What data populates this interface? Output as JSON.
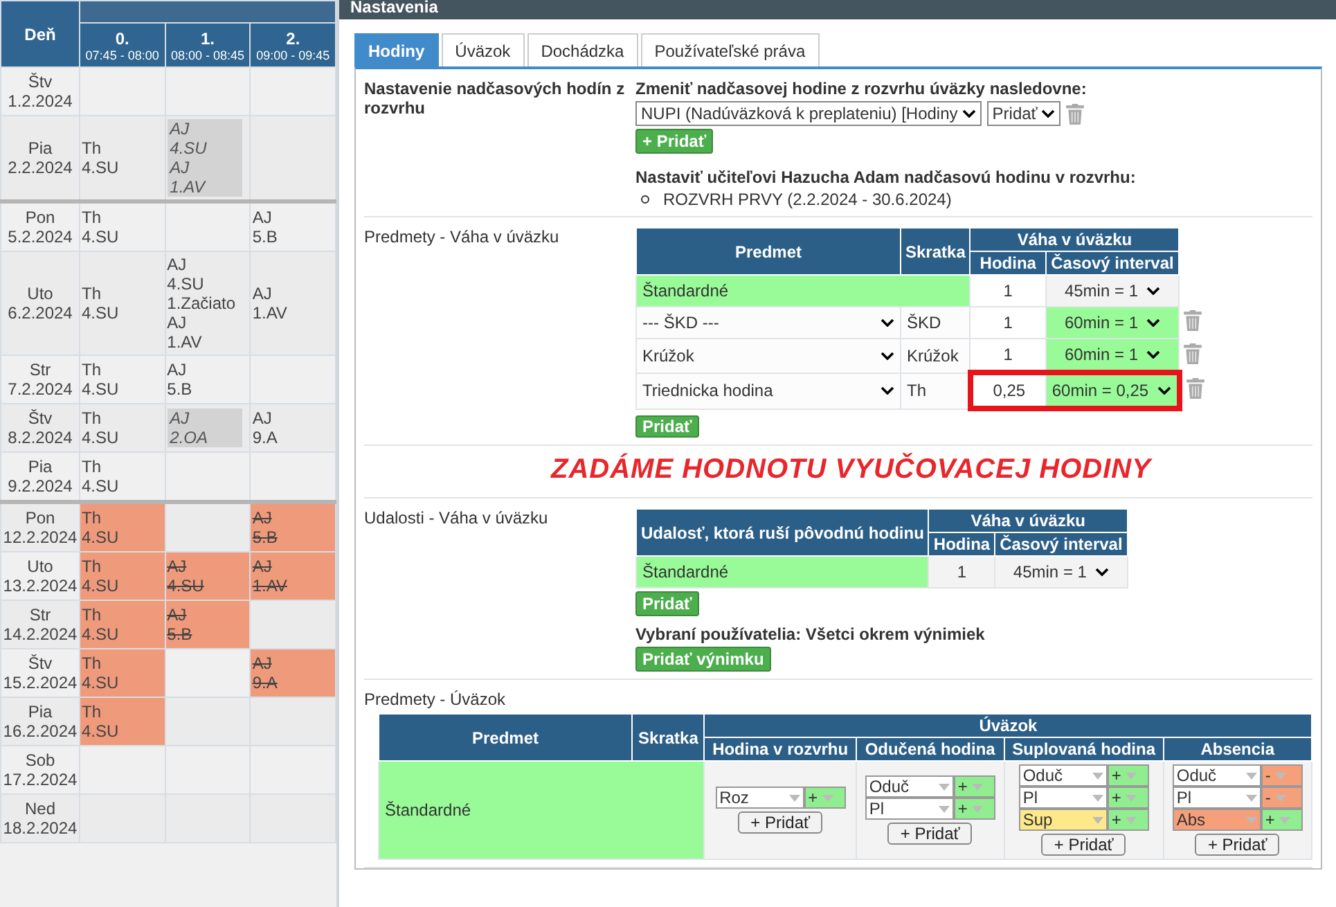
{
  "timetable": {
    "day_header": "Deň",
    "periods": [
      {
        "number": "0.",
        "time": "07:45 - 08:00"
      },
      {
        "number": "1.",
        "time": "08:00 - 08:45"
      },
      {
        "number": "2.",
        "time": "09:00 - 09:45"
      }
    ],
    "rows": [
      {
        "day": "Štv",
        "date": "1.2.2024",
        "week_start": false,
        "cells": [
          {
            "kind": "empty"
          },
          {
            "kind": "empty"
          },
          {
            "kind": "empty"
          }
        ]
      },
      {
        "day": "Pia",
        "date": "2.2.2024",
        "week_start": false,
        "cells": [
          {
            "kind": "lesson",
            "lines": [
              "Th",
              "4.SU"
            ]
          },
          {
            "kind": "moved",
            "lines": [
              "AJ",
              "4.SU",
              "AJ",
              "1.AV"
            ]
          },
          {
            "kind": "empty"
          }
        ]
      },
      {
        "day": "Pon",
        "date": "5.2.2024",
        "week_start": true,
        "cells": [
          {
            "kind": "lesson",
            "lines": [
              "Th",
              "4.SU"
            ]
          },
          {
            "kind": "empty"
          },
          {
            "kind": "lesson",
            "lines": [
              "AJ",
              "5.B"
            ]
          }
        ]
      },
      {
        "day": "Uto",
        "date": "6.2.2024",
        "week_start": false,
        "cells": [
          {
            "kind": "lesson",
            "lines": [
              "Th",
              "4.SU"
            ]
          },
          {
            "kind": "lesson",
            "lines": [
              "AJ",
              "4.SU",
              "1.Začiato",
              "AJ",
              "1.AV"
            ]
          },
          {
            "kind": "lesson",
            "lines": [
              "AJ",
              "1.AV"
            ]
          }
        ]
      },
      {
        "day": "Str",
        "date": "7.2.2024",
        "week_start": false,
        "cells": [
          {
            "kind": "lesson",
            "lines": [
              "Th",
              "4.SU"
            ]
          },
          {
            "kind": "lesson",
            "lines": [
              "AJ",
              "5.B"
            ]
          },
          {
            "kind": "empty"
          }
        ]
      },
      {
        "day": "Štv",
        "date": "8.2.2024",
        "week_start": false,
        "cells": [
          {
            "kind": "lesson",
            "lines": [
              "Th",
              "4.SU"
            ]
          },
          {
            "kind": "moved",
            "lines": [
              "AJ",
              "2.OA"
            ]
          },
          {
            "kind": "lesson",
            "lines": [
              "AJ",
              "9.A"
            ]
          }
        ]
      },
      {
        "day": "Pia",
        "date": "9.2.2024",
        "week_start": false,
        "cells": [
          {
            "kind": "lesson",
            "lines": [
              "Th",
              "4.SU"
            ]
          },
          {
            "kind": "empty"
          },
          {
            "kind": "empty"
          }
        ]
      },
      {
        "day": "Pon",
        "date": "12.2.2024",
        "week_start": true,
        "cells": [
          {
            "kind": "absent",
            "lines": [
              "Th",
              "4.SU"
            ]
          },
          {
            "kind": "empty"
          },
          {
            "kind": "cancelled",
            "lines": [
              "AJ",
              "5.B"
            ]
          }
        ]
      },
      {
        "day": "Uto",
        "date": "13.2.2024",
        "week_start": false,
        "cells": [
          {
            "kind": "absent",
            "lines": [
              "Th",
              "4.SU"
            ]
          },
          {
            "kind": "cancelled",
            "lines": [
              "AJ",
              "4.SU"
            ]
          },
          {
            "kind": "cancelled",
            "lines": [
              "AJ",
              "1.AV"
            ]
          }
        ]
      },
      {
        "day": "Str",
        "date": "14.2.2024",
        "week_start": false,
        "cells": [
          {
            "kind": "absent",
            "lines": [
              "Th",
              "4.SU"
            ]
          },
          {
            "kind": "cancelled",
            "lines": [
              "AJ",
              "5.B"
            ]
          },
          {
            "kind": "empty"
          }
        ]
      },
      {
        "day": "Štv",
        "date": "15.2.2024",
        "week_start": false,
        "cells": [
          {
            "kind": "absent",
            "lines": [
              "Th",
              "4.SU"
            ]
          },
          {
            "kind": "empty"
          },
          {
            "kind": "cancelled",
            "lines": [
              "AJ",
              "9.A"
            ]
          }
        ]
      },
      {
        "day": "Pia",
        "date": "16.2.2024",
        "week_start": false,
        "cells": [
          {
            "kind": "absent",
            "lines": [
              "Th",
              "4.SU"
            ]
          },
          {
            "kind": "empty"
          },
          {
            "kind": "empty"
          }
        ]
      },
      {
        "day": "Sob",
        "date": "17.2.2024",
        "week_start": false,
        "cells": [
          {
            "kind": "empty"
          },
          {
            "kind": "empty"
          },
          {
            "kind": "empty"
          }
        ]
      },
      {
        "day": "Ned",
        "date": "18.2.2024",
        "week_start": false,
        "cells": [
          {
            "kind": "empty"
          },
          {
            "kind": "empty"
          },
          {
            "kind": "empty"
          }
        ]
      }
    ]
  },
  "panel": {
    "title": "Nastavenia",
    "tabs": [
      {
        "label": "Hodiny",
        "selected": true
      },
      {
        "label": "Úväzok",
        "selected": false
      },
      {
        "label": "Dochádzka",
        "selected": false
      },
      {
        "label": "Používateľské práva",
        "selected": false
      }
    ],
    "overtime": {
      "label": "Nastavenie nadčasových hodín z rozvrhu",
      "heading": "Zmeniť nadčasovej hodine z rozvrhu úväzky nasledovne:",
      "type_select": "NUPI (Nadúväzková k preplateniu) [Hodiny",
      "action_select": "Pridať",
      "add_button": "+ Pridať",
      "schedule_heading": "Nastaviť učiteľovi Hazucha Adam nadčasovú hodinu v rozvrhu:",
      "schedules": [
        "ROZVRH PRVY (2.2.2024 - 30.6.2024)"
      ]
    },
    "subject_weights": {
      "label": "Predmety - Váha v úväzku",
      "headers": {
        "subject": "Predmet",
        "abbr": "Skratka",
        "group": "Váha v úväzku",
        "hours": "Hodina",
        "interval": "Časový interval"
      },
      "rows": [
        {
          "kind": "default",
          "subject": "Štandardné",
          "hours": "1",
          "interval": "45min = 1",
          "highlighted": false
        },
        {
          "kind": "subject",
          "subject": "--- ŠKD ---",
          "abbr": "ŠKD",
          "hours": "1",
          "interval": "60min = 1",
          "highlighted": false
        },
        {
          "kind": "subject",
          "subject": "Krúžok",
          "abbr": "Krúžok",
          "hours": "1",
          "interval": "60min = 1",
          "highlighted": false
        },
        {
          "kind": "subject",
          "subject": "Triednicka hodina",
          "abbr": "Th",
          "hours": "0,25",
          "interval": "60min = 0,25",
          "highlighted": true
        }
      ],
      "add_button": "Pridať"
    },
    "annotation": "ZADÁME HODNOTU VYUČOVACEJ HODINY",
    "event_weights": {
      "label": "Udalosti - Váha v úväzku",
      "headers": {
        "event": "Udalosť, ktorá ruší pôvodnú hodinu",
        "group": "Váha v úväzku",
        "hours": "Hodina",
        "interval": "Časový interval"
      },
      "rows": [
        {
          "event": "Štandardné",
          "hours": "1",
          "interval": "45min = 1"
        }
      ],
      "add_button": "Pridať",
      "users_text": "Vybraní používatelia: Všetci okrem výnimiek",
      "exception_button": "Pridať výnimku"
    },
    "subject_load": {
      "label": "Predmety - Úväzok",
      "headers": {
        "subject": "Predmet",
        "abbr": "Skratka",
        "group": "Úväzok",
        "columns": [
          "Hodina v rozvrhu",
          "Odučená hodina",
          "Suplovaná hodina",
          "Absencia"
        ]
      },
      "rows": [
        {
          "subject": "Štandardné",
          "groups": [
            {
              "items": [
                {
                  "value": "Roz",
                  "color": "#ffffff",
                  "sign": {
                    "label": "+",
                    "color": "#90ee90"
                  }
                }
              ],
              "button": "+ Pridať"
            },
            {
              "items": [
                {
                  "value": "Oduč",
                  "color": "#ffffff",
                  "sign": {
                    "label": "+",
                    "color": "#90ee90"
                  }
                },
                {
                  "value": "Pl",
                  "color": "#ffffff",
                  "sign": {
                    "label": "+",
                    "color": "#90ee90"
                  }
                }
              ],
              "button": "+ Pridať"
            },
            {
              "items": [
                {
                  "value": "Oduč",
                  "color": "#ffffff",
                  "sign": {
                    "label": "+",
                    "color": "#90ee90"
                  }
                },
                {
                  "value": "Pl",
                  "color": "#ffffff",
                  "sign": {
                    "label": "+",
                    "color": "#90ee90"
                  }
                },
                {
                  "value": "Sup",
                  "color": "#fde98a",
                  "sign": {
                    "label": "+",
                    "color": "#90ee90"
                  }
                }
              ],
              "button": "+ Pridať"
            },
            {
              "items": [
                {
                  "value": "Oduč",
                  "color": "#ffffff",
                  "sign": {
                    "label": "-",
                    "color": "#f5a07a"
                  }
                },
                {
                  "value": "Pl",
                  "color": "#ffffff",
                  "sign": {
                    "label": "-",
                    "color": "#f5a07a"
                  }
                },
                {
                  "value": "Abs",
                  "color": "#f5a07a",
                  "sign": {
                    "label": "+",
                    "color": "#90ee90"
                  }
                }
              ],
              "button": "+ Pridať"
            }
          ]
        }
      ]
    }
  }
}
